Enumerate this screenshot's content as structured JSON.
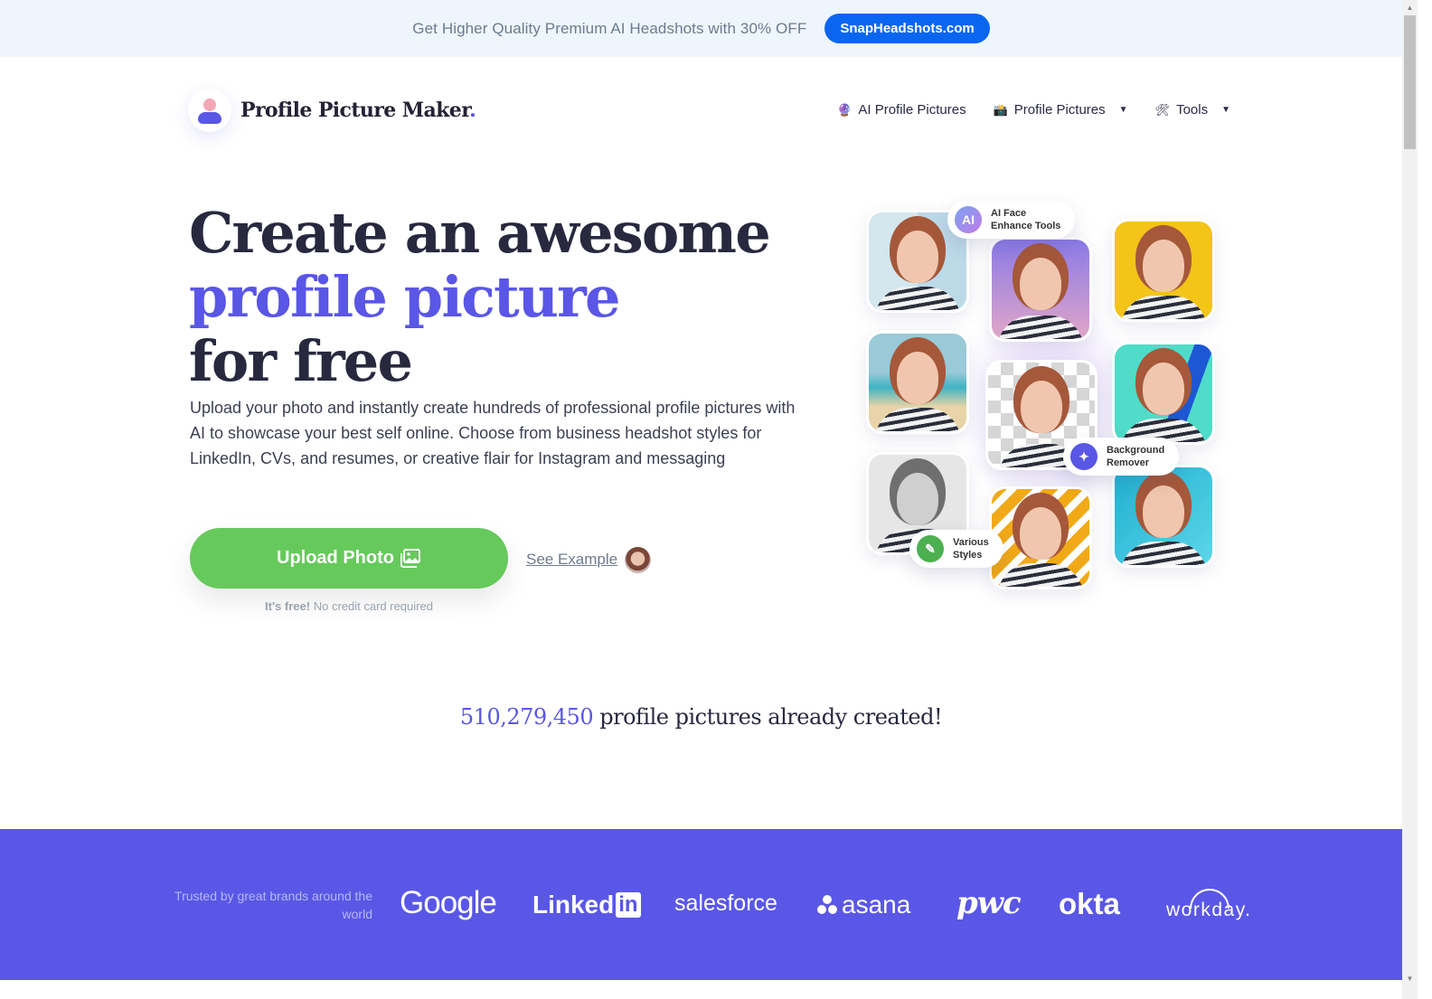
{
  "promo": {
    "text": "Get Higher Quality Premium AI Headshots with 30% OFF",
    "button_label": "SnapHeadshots.com",
    "button_color": "#0a66f0"
  },
  "header": {
    "logo_text": "Profile Picture Maker",
    "logo_dot": ".",
    "nav": [
      {
        "label": "AI Profile Pictures",
        "icon": "crystal-ball-icon",
        "glyph": "🔮",
        "dropdown": false
      },
      {
        "label": "Profile Pictures",
        "icon": "camera-flash-icon",
        "glyph": "📸",
        "dropdown": true,
        "caret": "▼"
      },
      {
        "label": "Tools",
        "icon": "tools-icon",
        "glyph": "🛠",
        "dropdown": true,
        "caret": "▼"
      }
    ]
  },
  "hero": {
    "title_line1": "Create an awesome",
    "title_line2": "profile picture",
    "title_line3": "for free",
    "description": "Upload your photo and instantly create hundreds of professional profile pictures with AI to showcase your best self online. Choose from business headshot styles for LinkedIn, CVs, and resumes, or creative flair for Instagram and messaging",
    "upload_label": "Upload Photo",
    "see_example_label": "See Example",
    "free_bold": "It's free!",
    "free_rest": "No credit card required",
    "accent_color": "#5a56e6",
    "upload_color": "#66c95b"
  },
  "collage": {
    "pills": [
      {
        "icon_text": "AI",
        "line1": "AI Face",
        "line2": "Enhance Tools"
      },
      {
        "icon_text": "✦",
        "line1": "Background",
        "line2": "Remover"
      },
      {
        "icon_text": "✎",
        "line1": "Various",
        "line2": "Styles"
      }
    ]
  },
  "counter": {
    "number": "510,279,450",
    "text": "profile pictures already created!"
  },
  "brands": {
    "trusted_text": "Trusted by great brands around the world",
    "logos": [
      "Google",
      "Linked",
      "in",
      "salesforce",
      "asana",
      "pwc",
      "okta",
      "workday."
    ],
    "background": "#5a57e6"
  },
  "scrollbar": {
    "up": "▲",
    "down": "▼"
  }
}
